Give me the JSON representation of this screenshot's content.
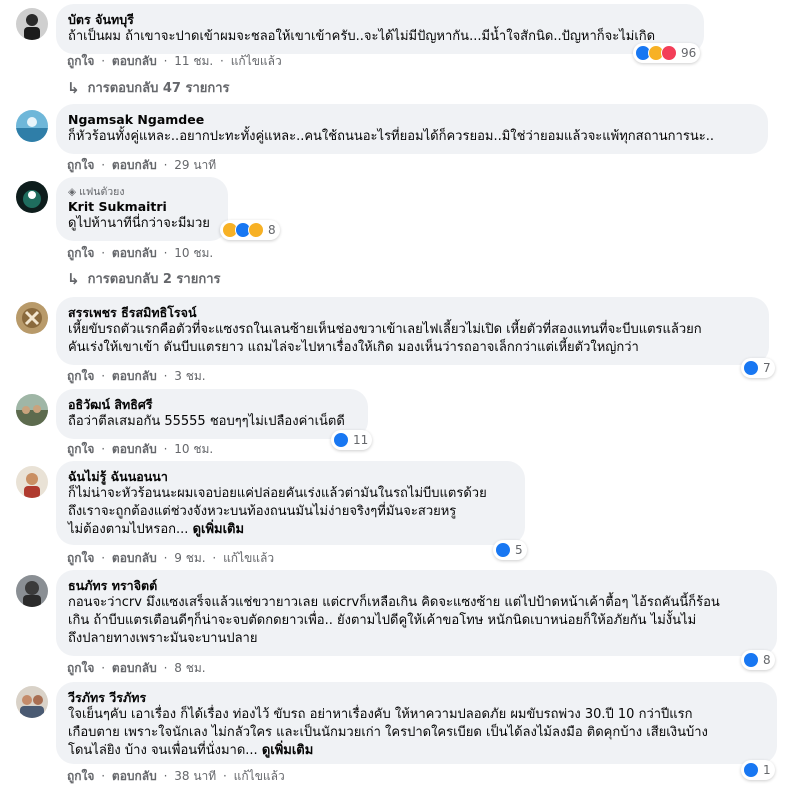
{
  "actions": {
    "like": "ถูกใจ",
    "reply": "ตอบกลับ",
    "edited": "แก้ไขแล้ว",
    "separator": "·"
  },
  "comments": [
    {
      "author": "บัตร จันทบุรี",
      "lines": [
        "ถ้าเป็นผม ถ้าเขาจะปาดเข้าผมจะชลอให้เขาเข้าครับ..จะได้ไม่มีปัญหากัน...มีน้ำใจสักนิด..ปัญหาก็จะไม่เกิด"
      ],
      "time": "11 ชม.",
      "edited": true,
      "reactions": [
        "like-icon",
        "haha-icon",
        "love-icon"
      ],
      "reaction_count": "96",
      "replies": "การตอบกลับ 47 รายการ"
    },
    {
      "author": "Ngamsak Ngamdee",
      "lines": [
        "ก็หัวร้อนทั้งคู่แหละ..อยากปะทะทั้งคู่แหละ..คนใช้ถนนอะไรที่ยอมได้ก็ควรยอม..มิใช่ว่ายอมแล้วจะแพ้ทุกสถานการนะ.."
      ],
      "time": "29 นาที",
      "edited": false
    },
    {
      "badge": "แฟนตัวยง",
      "author": "Krit Sukmaitri",
      "lines": [
        "ดูไปห้านาทีนี่กว่าจะมีมวย"
      ],
      "time": "10 ชม.",
      "edited": false,
      "reactions": [
        "haha-icon",
        "like-icon",
        "care-icon"
      ],
      "reaction_count": "8",
      "replies": "การตอบกลับ 2 รายการ"
    },
    {
      "author": "สรรเพชร ธีรสมิทธิโรจน์",
      "lines": [
        "เหี้ยขับรถตัวแรกคือตัวที่จะแซงรถในเลนซ้ายเห็นช่องขวาเข้าเลยไฟเลี้ยวไม่เปิด เหี้ยตัวที่สองแทนที่จะบีบแตรแล้วยก",
        "คันเร่งให้เขาเข้า ดันบีบแตรยาว แถมไล่จะไปหาเรื่องให้เกิด มองเห็นว่ารถอาจเล็กกว่าแต่เหี้ยตัวใหญ่กว่า"
      ],
      "time": "3 ชม.",
      "edited": false,
      "reactions": [
        "like-icon"
      ],
      "reaction_count": "7"
    },
    {
      "author": "อธิวัฒน์ สิทธิศรี",
      "lines": [
        "ถือว่าตีลเสมอกัน 55555 ชอบๆๆไม่เปลืองค่าเน็ตดี"
      ],
      "time": "10 ชม.",
      "edited": false,
      "reactions": [
        "like-icon"
      ],
      "reaction_count": "11"
    },
    {
      "author": "ฉันไม่รู้ ฉันนอนนา",
      "lines": [
        "ก็ไม่น่าจะหัวร้อนนะผมเจอบ่อยแค่ปล่อยคันเร่งแล้วต่ามันในรถไม่บีบแตรด้วย",
        "ถึงเราจะถูกต้องแต่ช่วงจังหวะบนท้องถนนมันไม่ง่ายจริงๆที่มันจะสวยหรู",
        "ไม่ต้องตามไปหรอก..."
      ],
      "see_more": "ดูเพิ่มเติม",
      "time": "9 ชม.",
      "edited": true,
      "reactions": [
        "like-icon"
      ],
      "reaction_count": "5"
    },
    {
      "author": "ธนภัทร ทราจิตต์",
      "lines": [
        "กอนจะว่าcrv มึงแซงเสร็จแล้วแช่ขวายาวเลย แต่crvก็เหลือเกิน คิดจะแซงซ้าย แต่ไปป้าดหน้าเค้าตื้อๆ ไอ้รถคันนี้ก็ร้อน",
        "เกิน ถ้าบีบแตรเตือนดีๆก็น่าจะจบตัดกดยาวเพื่อ.. ยังตามไปดีคูให้เค้าขอโทษ หนักนิดเบาหน่อยก็ให้อภัยกัน ไม่งั้นไม่",
        "ถึงปลายทางเพราะมันจะบานปลาย"
      ],
      "time": "8 ชม.",
      "edited": false,
      "reactions": [
        "like-icon"
      ],
      "reaction_count": "8"
    },
    {
      "author": "วีรภัทร วีรภัทร",
      "lines": [
        "ใจเย็นๆคับ เอาเรื่อง ก็ได้เรื่อง ท่องไว้ ขับรถ อย่าหาเรื่องคับ ให้หาความปลอดภัย ผมขับรถพ่วง 30.ปี 10 กว่าปีแรก",
        "เกือบตาย เพราะใจนักเลง ไม่กลัวใคร และเป็นนักมวยเก่า ใครปาดใครเบียด เป็นได้ลงไม้ลงมือ ติดคุกบ้าง เสียเงินบ้าง",
        "โดนไล่ยิง บ้าง จนเพื่อนที่นั่งมาด..."
      ],
      "see_more": "ดูเพิ่มเติม",
      "time": "38 นาที",
      "edited": true,
      "reactions": [
        "like-icon"
      ],
      "reaction_count": "1"
    }
  ],
  "colors": {
    "bubble": "#f0f2f5",
    "meta": "#65676b",
    "like": "#1877f2",
    "haha": "#f7b125",
    "love": "#f33e58"
  }
}
